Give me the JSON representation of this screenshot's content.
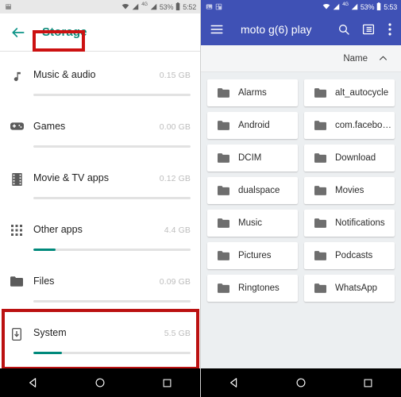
{
  "left": {
    "statusbar": {
      "time": "5:52",
      "battery": "53%",
      "network": "4G",
      "icons": [
        "sim-card-icon",
        "wifi-icon",
        "signal-icon",
        "signal-icon-2",
        "battery-icon"
      ]
    },
    "appbar": {
      "back_icon": "back-arrow-icon",
      "title": "Storage",
      "title_color": "#0f8a7a",
      "highlight_color": "#cc1111"
    },
    "items": [
      {
        "icon": "music-note-icon",
        "label": "Music & audio",
        "size": "0.15 GB",
        "fill_pct": 0
      },
      {
        "icon": "gamepad-icon",
        "label": "Games",
        "size": "0.00 GB",
        "fill_pct": 0
      },
      {
        "icon": "film-strip-icon",
        "label": "Movie & TV apps",
        "size": "0.12 GB",
        "fill_pct": 0
      },
      {
        "icon": "apps-grid-icon",
        "label": "Other apps",
        "size": "4.4 GB",
        "fill_pct": 14
      },
      {
        "icon": "folder-icon",
        "label": "Files",
        "size": "0.09 GB",
        "fill_pct": 0
      },
      {
        "icon": "system-phone-icon",
        "label": "System",
        "size": "5.5 GB",
        "fill_pct": 18
      }
    ],
    "highlighted_item_index": 4,
    "navbar": {
      "back": "nav-back-triangle-icon",
      "home": "nav-home-circle-icon",
      "recents": "nav-recents-square-icon"
    }
  },
  "right": {
    "statusbar": {
      "time": "5:53",
      "battery": "53%",
      "network": "4G",
      "icons": [
        "image-icon",
        "screenshot-icon",
        "wifi-icon",
        "signal-icon",
        "signal-icon-2",
        "battery-icon"
      ]
    },
    "appbar": {
      "menu_icon": "hamburger-menu-icon",
      "title": "moto g(6) play",
      "search_icon": "search-icon",
      "view_icon": "list-view-icon",
      "overflow_icon": "overflow-menu-icon",
      "background": "#3f51b5"
    },
    "sortbar": {
      "label": "Name",
      "direction_icon": "chevron-up-icon"
    },
    "folders": [
      "Alarms",
      "alt_autocycle",
      "Android",
      "com.facebo…",
      "DCIM",
      "Download",
      "dualspace",
      "Movies",
      "Music",
      "Notifications",
      "Pictures",
      "Podcasts",
      "Ringtones",
      "WhatsApp"
    ],
    "navbar": {
      "back": "nav-back-triangle-icon",
      "home": "nav-home-circle-icon",
      "recents": "nav-recents-square-icon"
    }
  }
}
